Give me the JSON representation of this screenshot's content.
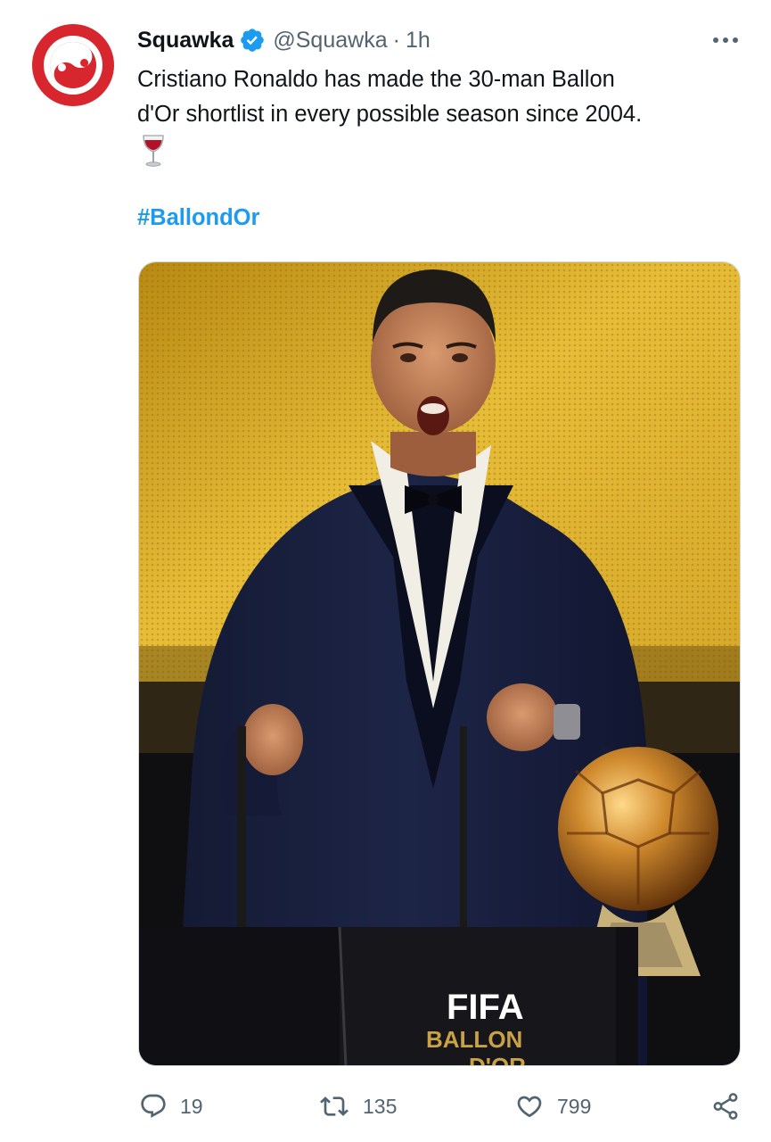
{
  "tweet": {
    "display_name": "Squawka",
    "verified": true,
    "handle": "@Squawka",
    "separator": "·",
    "time": "1h",
    "text_lines": [
      "Cristiano Ronaldo has made the 30-man Ballon",
      "d'Or shortlist in every possible season since 2004."
    ],
    "emoji": "wine-glass-emoji",
    "hashtag": "#BallondOr",
    "media": {
      "podium_text_top": "FIFA",
      "podium_text_bottom": "BALLON",
      "podium_text_cut": "D'OR"
    },
    "actions": {
      "replies": "19",
      "retweets": "135",
      "likes": "799"
    }
  },
  "colors": {
    "brand_red": "#d7262e",
    "link_blue": "#1d9bf0",
    "secondary_text": "#536471"
  },
  "icons": [
    "squawka-logo",
    "verified-badge-icon",
    "more-options-icon",
    "reply-icon",
    "retweet-icon",
    "like-icon",
    "share-icon"
  ]
}
